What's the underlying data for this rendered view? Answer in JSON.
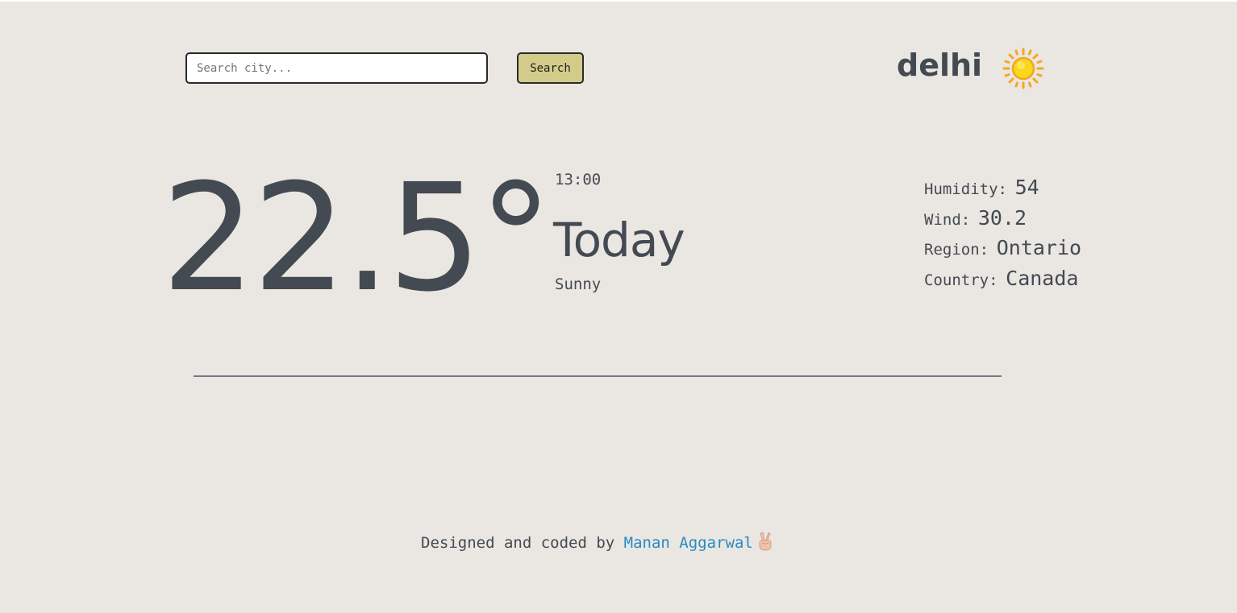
{
  "search": {
    "placeholder": "Search city...",
    "value": "",
    "button_label": "Search"
  },
  "location": {
    "city": "delhi",
    "weather_icon": "sun-icon"
  },
  "current": {
    "temperature": "22.5°",
    "time": "13:00",
    "day": "Today",
    "condition": "Sunny"
  },
  "details": [
    {
      "label": "Humidity:",
      "value": "54"
    },
    {
      "label": "Wind:",
      "value": "30.2"
    },
    {
      "label": "Region:",
      "value": "Ontario"
    },
    {
      "label": "Country:",
      "value": "Canada"
    }
  ],
  "footer": {
    "prefix": "Designed and coded by",
    "author_link": "Manan Aggarwal",
    "emoji_icon": "peace-hand-icon"
  },
  "colors": {
    "background": "#eae6e1",
    "text": "#434a52",
    "button": "#d2cc8b",
    "link": "#2a8ac4",
    "sun": "#f9d71c"
  }
}
